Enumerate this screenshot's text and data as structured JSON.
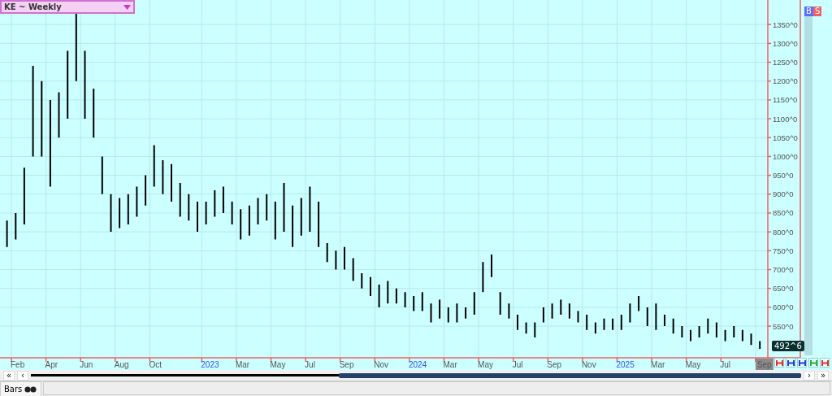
{
  "chart_title": "KE ~ Weekly",
  "signal_buttons": [
    {
      "label": "B",
      "kind": "buy"
    },
    {
      "label": "S",
      "kind": "sell"
    }
  ],
  "last_price": "492^6",
  "price_axis": {
    "labels": [
      "1350^0",
      "1300^0",
      "1250^0",
      "1200^0",
      "1150^0",
      "1100^0",
      "1050^0",
      "1000^0",
      "950^0",
      "900^0",
      "850^0",
      "800^0",
      "750^0",
      "700^0",
      "650^0",
      "600^0",
      "550^0"
    ]
  },
  "date_axis": {
    "labels": [
      {
        "label": "Feb",
        "kind": "month",
        "selected": false
      },
      {
        "label": "Apr",
        "kind": "month",
        "selected": false
      },
      {
        "label": "Jun",
        "kind": "month",
        "selected": false
      },
      {
        "label": "Aug",
        "kind": "month",
        "selected": false
      },
      {
        "label": "Oct",
        "kind": "month",
        "selected": false
      },
      {
        "label": "2023",
        "kind": "year",
        "selected": false
      },
      {
        "label": "Mar",
        "kind": "month",
        "selected": false
      },
      {
        "label": "May",
        "kind": "month",
        "selected": false
      },
      {
        "label": "Jul",
        "kind": "month",
        "selected": false
      },
      {
        "label": "Sep",
        "kind": "month",
        "selected": false
      },
      {
        "label": "Nov",
        "kind": "month",
        "selected": false
      },
      {
        "label": "2024",
        "kind": "year",
        "selected": false
      },
      {
        "label": "Mar",
        "kind": "month",
        "selected": false
      },
      {
        "label": "May",
        "kind": "month",
        "selected": false
      },
      {
        "label": "Jul",
        "kind": "month",
        "selected": false
      },
      {
        "label": "Sep",
        "kind": "month",
        "selected": false
      },
      {
        "label": "Nov",
        "kind": "month",
        "selected": false
      },
      {
        "label": "2025",
        "kind": "year",
        "selected": false
      },
      {
        "label": "Mar",
        "kind": "month",
        "selected": false
      },
      {
        "label": "May",
        "kind": "month",
        "selected": false
      },
      {
        "label": "Jul",
        "kind": "month",
        "selected": false
      },
      {
        "label": "Sep",
        "kind": "month",
        "selected": true
      }
    ]
  },
  "tool_buttons": [
    {
      "color": "#e83030"
    },
    {
      "color": "#2040e0"
    },
    {
      "color": "#2040e0"
    },
    {
      "color": "#20b040"
    },
    {
      "color": "#e83030"
    }
  ],
  "scrollbar": {
    "level": 0.6,
    "buttons": [
      "«",
      "‹",
      "›",
      "»"
    ]
  },
  "bottom_tabs": [
    {
      "label": "Bars",
      "selected": true
    }
  ]
}
